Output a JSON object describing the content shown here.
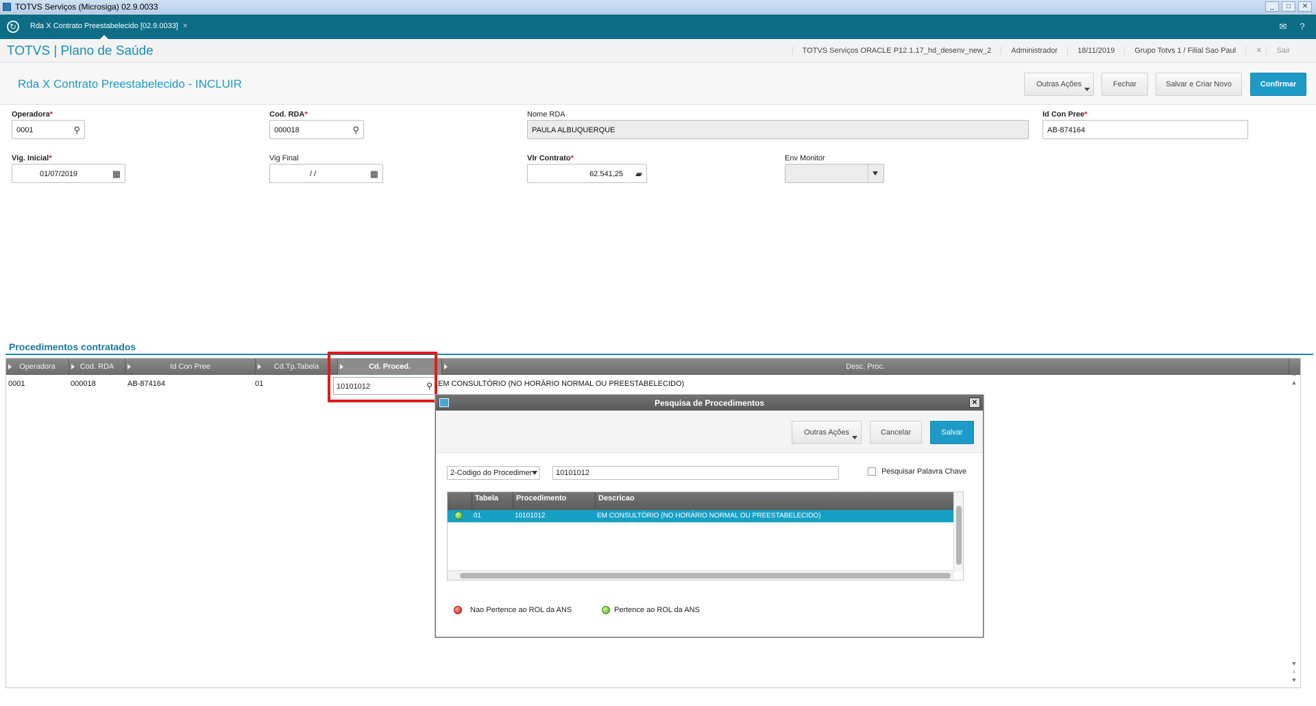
{
  "window": {
    "title": "TOTVS Serviços (Microsiga) 02.9.0033",
    "controls": [
      "_",
      "□",
      "✕"
    ]
  },
  "tabbar": {
    "tab_label": "Rda X Contrato Preestabelecido [02.9.0033]",
    "tab_close": "×",
    "mail_icon": "✉",
    "help_icon": "?"
  },
  "header": {
    "brand": "TOTVS | Plano de Saúde",
    "environment": "TOTVS Serviços ORACLE P12.1.17_hd_desenv_new_2",
    "user": "Administrador",
    "date": "18/11/2019",
    "branch": "Grupo Totvs 1 / Filial Sao Paul",
    "exit_label": "Sair"
  },
  "page": {
    "title": "Rda X Contrato Preestabelecido - INCLUIR",
    "buttons": {
      "outras": "Outras Ações",
      "fechar": "Fechar",
      "salvar_novo": "Salvar e Criar Novo",
      "confirmar": "Confirmar"
    }
  },
  "form": {
    "operadora": {
      "label": "Operadora",
      "value": "0001"
    },
    "cod_rda": {
      "label": "Cod. RDA",
      "value": "000018"
    },
    "nome_rda": {
      "label": "Nome RDA",
      "value": "PAULA ALBUQUERQUE"
    },
    "id_con_pree": {
      "label": "Id Con Pree",
      "value": "AB-874164"
    },
    "vig_inicial": {
      "label": "Vig. Inicial",
      "value": "01/07/2019"
    },
    "vig_final": {
      "label": "Vig Final",
      "value": "/ /"
    },
    "vlr_contrato": {
      "label": "Vlr Contrato",
      "value": "62.541,25"
    },
    "env_monitor": {
      "label": "Env Monitor",
      "value": ""
    },
    "required_mark": "*"
  },
  "section": {
    "title": "Procedimentos contratados",
    "columns": [
      "Operadora",
      "Cod. RDA",
      "Id Con Pree",
      "Cd.Tp.Tabela",
      "Cd. Proced.",
      "Desc. Proc."
    ],
    "rows": [
      {
        "operadora": "0001",
        "cod_rda": "000018",
        "id_con_pree": "AB-874164",
        "tp_tabela": "01",
        "cd_proced": "10101012",
        "desc": "EM CONSULTÓRIO (NO HORÁRIO NORMAL OU PREESTABELECIDO)"
      }
    ]
  },
  "dialog": {
    "title": "Pesquisa de Procedimentos",
    "buttons": {
      "outras": "Outras Ações",
      "cancelar": "Cancelar",
      "salvar": "Salvar"
    },
    "search_type": "2-Codigo do Procedimer",
    "search_value": "10101012",
    "keyword_label": "Pesquisar Palavra Chave",
    "columns": [
      "Tabela",
      "Procedimento",
      "Descricao"
    ],
    "rows": [
      {
        "status": "green",
        "tabela": "01",
        "procedimento": "10101012",
        "descricao": "EM CONSULTÓRIO (NO HORÁRIO NORMAL OU PREESTABELECIDO)"
      }
    ],
    "legend": {
      "red": "Nao Pertence ao ROL da ANS",
      "green": "Pertence ao ROL da ANS"
    }
  },
  "colors": {
    "accent": "#1e9ac6",
    "tabbar": "#0e6d86",
    "highlight": "#e21b1b"
  }
}
